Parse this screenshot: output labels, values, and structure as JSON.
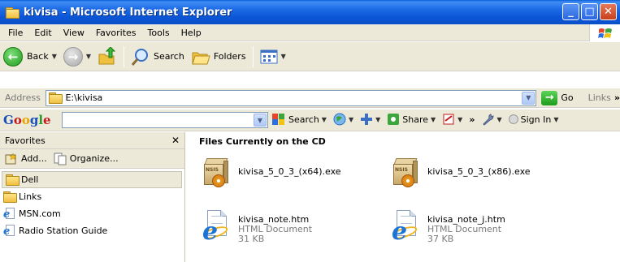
{
  "window": {
    "title": "kivisa - Microsoft Internet Explorer"
  },
  "menubar": {
    "items": [
      {
        "label": "File"
      },
      {
        "label": "Edit"
      },
      {
        "label": "View"
      },
      {
        "label": "Favorites"
      },
      {
        "label": "Tools"
      },
      {
        "label": "Help"
      }
    ]
  },
  "toolbar": {
    "back_label": "Back",
    "search_label": "Search",
    "folders_label": "Folders"
  },
  "address": {
    "label": "Address",
    "value": "E:\\kivisa",
    "go_label": "Go",
    "links_label": "Links"
  },
  "google": {
    "logo": [
      "G",
      "o",
      "o",
      "g",
      "l",
      "e"
    ],
    "search_label": "Search",
    "share_label": "Share",
    "signin_label": "Sign In",
    "more": "»"
  },
  "favorites": {
    "title": "Favorites",
    "add_label": "Add...",
    "organize_label": "Organize...",
    "items": [
      {
        "label": "Dell",
        "icon": "folder-icon"
      },
      {
        "label": "Links",
        "icon": "folder-icon"
      },
      {
        "label": "MSN.com",
        "icon": "ie-page-icon"
      },
      {
        "label": "Radio Station Guide",
        "icon": "ie-page-icon"
      }
    ]
  },
  "content": {
    "title": "Files Currently on the CD",
    "files": [
      {
        "name": "kivisa_5_0_3_(x64).exe",
        "type": "",
        "size": "",
        "icon": "nsis-installer-icon"
      },
      {
        "name": "kivisa_5_0_3_(x86).exe",
        "type": "",
        "size": "",
        "icon": "nsis-installer-icon"
      },
      {
        "name": "kivisa_note.htm",
        "type": "HTML Document",
        "size": "31 KB",
        "icon": "ie-document-icon"
      },
      {
        "name": "kivisa_note_j.htm",
        "type": "HTML Document",
        "size": "37 KB",
        "icon": "ie-document-icon"
      }
    ]
  }
}
